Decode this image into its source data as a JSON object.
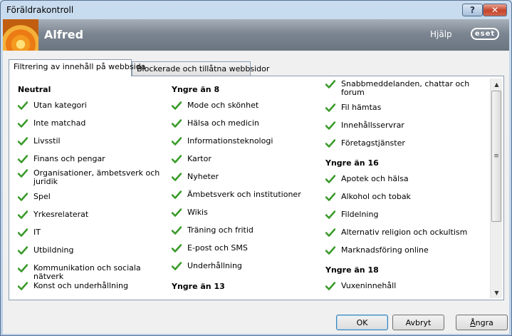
{
  "window": {
    "title": "Föräldrakontroll"
  },
  "header": {
    "username": "Alfred",
    "help_label": "Hjälp",
    "logo_text": "eset"
  },
  "tabs": [
    {
      "label": "Filtrering av innehåll på webbsida",
      "active": true
    },
    {
      "label": "Blockerade och tillåtna webbsidor",
      "active": false
    }
  ],
  "columns": [
    {
      "entries": [
        {
          "kind": "category",
          "label": "Neutral"
        },
        {
          "kind": "item",
          "label": "Utan kategori"
        },
        {
          "kind": "item",
          "label": "Inte matchad"
        },
        {
          "kind": "item",
          "label": "Livsstil"
        },
        {
          "kind": "item",
          "label": "Finans och pengar"
        },
        {
          "kind": "item",
          "label": "Organisationer, ämbetsverk och juridik"
        },
        {
          "kind": "item",
          "label": "Spel"
        },
        {
          "kind": "item",
          "label": "Yrkesrelaterat"
        },
        {
          "kind": "item",
          "label": "IT"
        },
        {
          "kind": "item",
          "label": "Utbildning"
        },
        {
          "kind": "item",
          "label": "Kommunikation och sociala nätverk"
        },
        {
          "kind": "item",
          "label": "Konst och underhållning"
        }
      ]
    },
    {
      "entries": [
        {
          "kind": "category",
          "label": "Yngre än 8"
        },
        {
          "kind": "item",
          "label": "Mode och skönhet"
        },
        {
          "kind": "item",
          "label": "Hälsa och medicin"
        },
        {
          "kind": "item",
          "label": "Informationsteknologi"
        },
        {
          "kind": "item",
          "label": "Kartor"
        },
        {
          "kind": "item",
          "label": "Nyheter"
        },
        {
          "kind": "item",
          "label": "Ämbetsverk och institutioner"
        },
        {
          "kind": "item",
          "label": "Wikis"
        },
        {
          "kind": "item",
          "label": "Träning och fritid"
        },
        {
          "kind": "item",
          "label": "E-post och SMS"
        },
        {
          "kind": "item",
          "label": "Underhållning"
        },
        {
          "kind": "category",
          "label": "Yngre än 13"
        }
      ]
    },
    {
      "entries": [
        {
          "kind": "item",
          "label": "Snabbmeddelanden, chattar och forum"
        },
        {
          "kind": "item",
          "label": "Fil hämtas"
        },
        {
          "kind": "item",
          "label": "Innehållsservrar"
        },
        {
          "kind": "item",
          "label": "Företagstjänster"
        },
        {
          "kind": "category",
          "label": "Yngre än 16"
        },
        {
          "kind": "item",
          "label": "Apotek och hälsa"
        },
        {
          "kind": "item",
          "label": "Alkohol och tobak"
        },
        {
          "kind": "item",
          "label": "Fildelning"
        },
        {
          "kind": "item",
          "label": "Alternativ religion och ockultism"
        },
        {
          "kind": "item",
          "label": "Marknadsföring online"
        },
        {
          "kind": "category",
          "label": "Yngre än 18"
        },
        {
          "kind": "item",
          "label": "Vuxeninnehåll"
        }
      ]
    }
  ],
  "footer": {
    "ok_label": "OK",
    "cancel_label": "Avbryt",
    "undo_prefix": "",
    "undo_accel": "Å",
    "undo_rest": "ngra"
  },
  "colors": {
    "check": "#3a9b2a",
    "header_bg": "#7c8692"
  }
}
